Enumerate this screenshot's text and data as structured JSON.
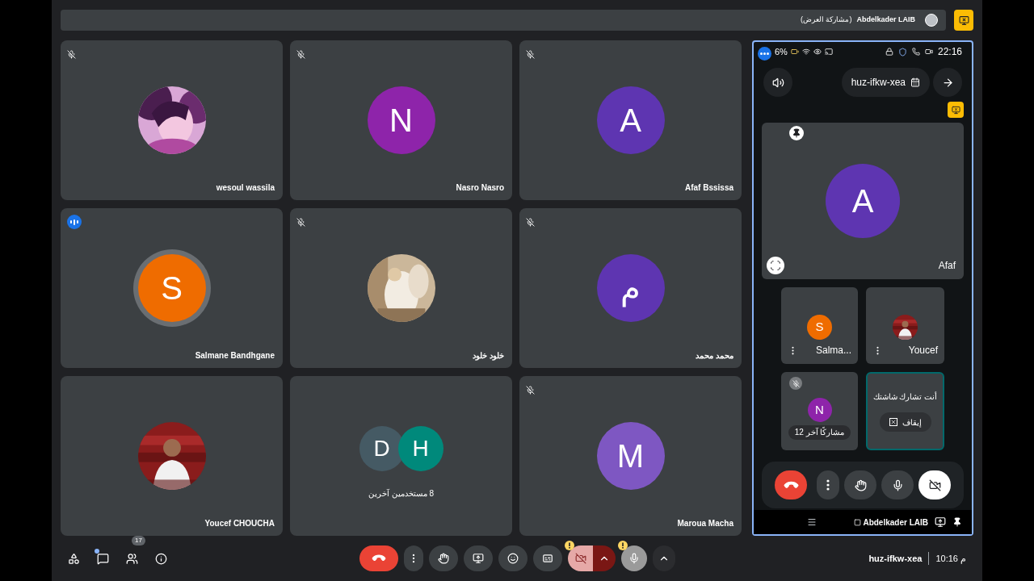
{
  "top_bar": {
    "presenter": "Abdelkader LAIB",
    "note": "(مشاركة العرض)"
  },
  "tiles": [
    {
      "kind": "person",
      "name": "Afaf Bssissa",
      "muted": true,
      "speaking": false,
      "avatar": {
        "kind": "letter",
        "letter": "A",
        "color": "#5e35b1"
      }
    },
    {
      "kind": "person",
      "name": "Nasro Nasro",
      "muted": true,
      "speaking": false,
      "avatar": {
        "kind": "letter",
        "letter": "N",
        "color": "#8e24aa"
      }
    },
    {
      "kind": "person",
      "name": "wesoul wassila",
      "muted": true,
      "speaking": false
    },
    {
      "kind": "person",
      "name": "محمد محمد",
      "muted": true,
      "speaking": false,
      "avatar": {
        "kind": "letter",
        "letter": "م",
        "color": "#5e35b1"
      }
    },
    {
      "kind": "person",
      "name": "خلود خلود",
      "muted": true,
      "speaking": false
    },
    {
      "kind": "person",
      "name": "Salmane Bandhgane",
      "muted": false,
      "speaking": true,
      "avatar": {
        "kind": "letter",
        "letter": "S",
        "color": "#ef6c00"
      }
    },
    {
      "kind": "person",
      "name": "Maroua Macha",
      "muted": true,
      "speaking": false,
      "avatar": {
        "kind": "letter",
        "letter": "M",
        "color": "#7e57c2"
      }
    },
    {
      "kind": "group",
      "label": "8 مستخدمين آخرين",
      "avatars": [
        {
          "kind": "letter",
          "letter": "H",
          "color": "#00897b"
        },
        {
          "kind": "letter",
          "letter": "D",
          "color": "#455a64"
        }
      ]
    },
    {
      "kind": "person",
      "name": "Youcef CHOUCHA",
      "muted": false,
      "speaking": false
    }
  ],
  "phone": {
    "status_bar": {
      "battery": "6%",
      "time": "22:16"
    },
    "meeting_code": "huz-ifkw-xea",
    "main_tile": {
      "name": "Afaf",
      "avatar": {
        "kind": "letter",
        "letter": "A",
        "color": "#5e35b1"
      }
    },
    "small_tiles": [
      {
        "kind": "person",
        "name": "Youcef"
      },
      {
        "kind": "person",
        "name": "Salma...",
        "avatar": {
          "kind": "letter",
          "letter": "S",
          "color": "#ef6c00"
        }
      },
      {
        "kind": "sharing",
        "message": "أنت تشارك شاشتك",
        "button": "إيقاف"
      },
      {
        "kind": "others",
        "label": "12 مشاركًا آخر",
        "muted": true,
        "avatar": {
          "kind": "letter",
          "letter": "N",
          "color": "#8e24aa"
        }
      }
    ],
    "controls": [
      {
        "kind": "hangup"
      },
      {
        "kind": "more"
      },
      {
        "kind": "hand"
      },
      {
        "kind": "mic"
      },
      {
        "kind": "camera_off"
      }
    ],
    "owner": "Abdelkader LAIB"
  },
  "bottom_bar": {
    "left": [
      {
        "kind": "activities",
        "unread": false
      },
      {
        "kind": "chat",
        "unread": true
      },
      {
        "kind": "people",
        "unread": false,
        "badge": "17"
      },
      {
        "kind": "info",
        "unread": false
      }
    ],
    "controls": [
      {
        "kind": "hangup",
        "warning": false
      },
      {
        "kind": "more",
        "warning": false
      },
      {
        "kind": "hand",
        "warning": false
      },
      {
        "kind": "present",
        "warning": false
      },
      {
        "kind": "emoji",
        "warning": false
      },
      {
        "kind": "captions",
        "warning": false
      },
      {
        "kind": "camera_off",
        "warning": true
      },
      {
        "kind": "chevron_alert",
        "warning": false
      },
      {
        "kind": "mic",
        "warning": true
      },
      {
        "kind": "chevron",
        "warning": false
      }
    ],
    "meeting_code": "huz-ifkw-xea",
    "time": "10:16 م"
  }
}
